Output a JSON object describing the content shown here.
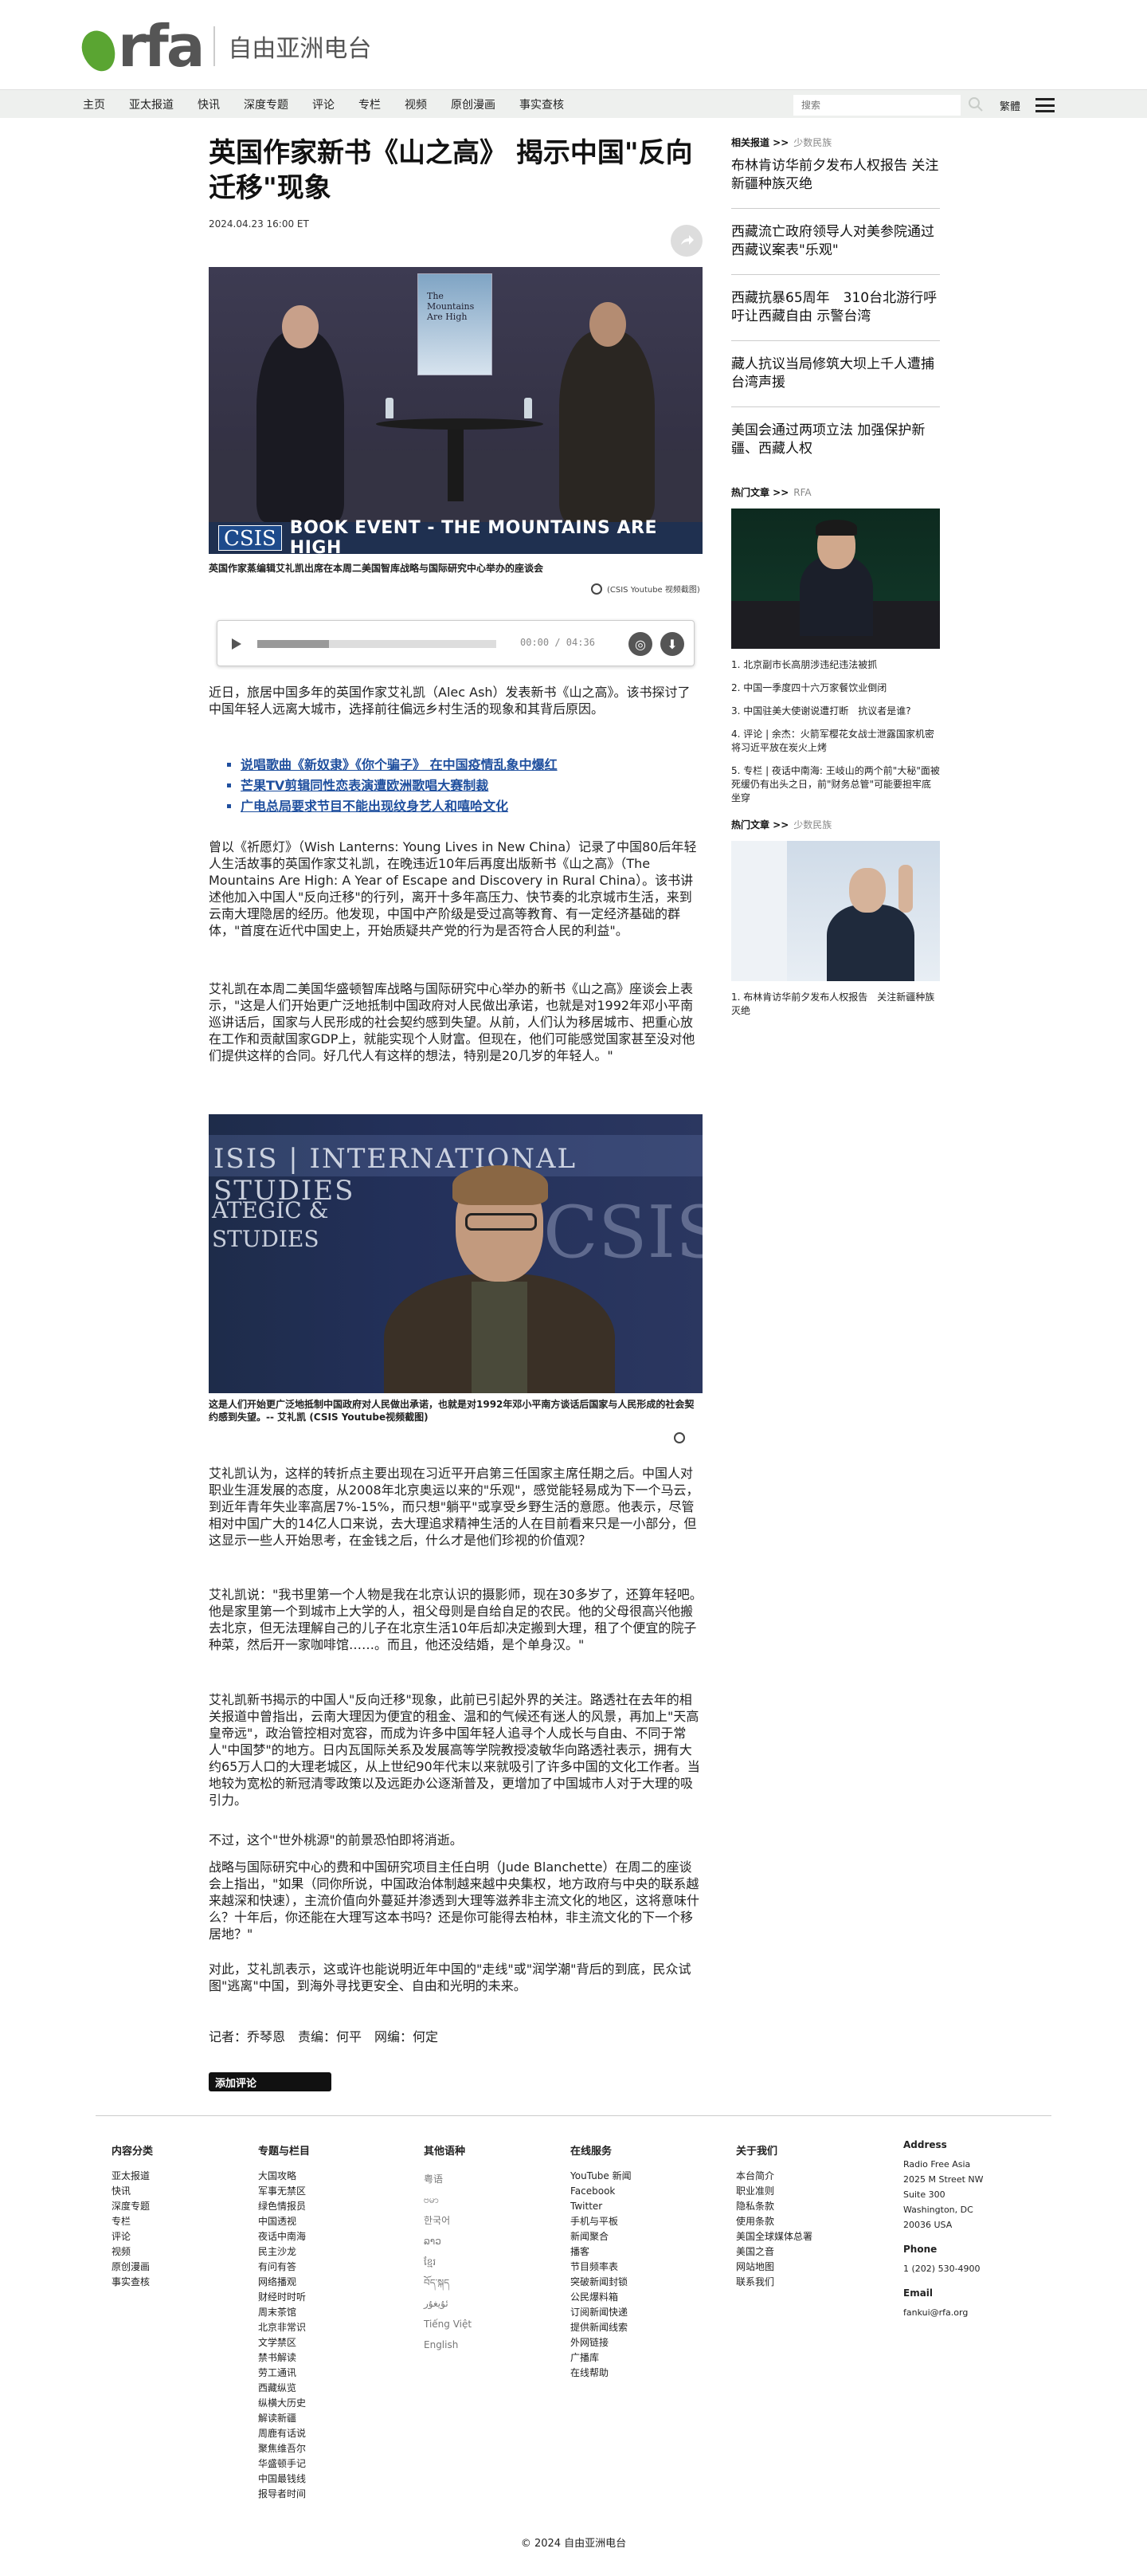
{
  "header": {
    "logo_text": "rfa",
    "site_name": "自由亚洲电台"
  },
  "nav": {
    "items": [
      "主页",
      "亚太报道",
      "快讯",
      "深度专题",
      "评论",
      "专栏",
      "视频",
      "原创漫画",
      "事实查核"
    ],
    "search_placeholder": "搜索",
    "lang_link": "繁體"
  },
  "article": {
    "headline": "英国作家新书《山之高》 揭示中国\"反向迁移\"现象",
    "date": "2024.04.23 16:00 ET",
    "hero": {
      "book_title": "The Mountains Are High",
      "banner_brand": "CSIS",
      "banner_text": "BOOK EVENT - THE MOUNTAINS ARE HIGH"
    },
    "caption1": "英国作家蒸编辑艾礼凯出席在本周二美国智库战略与国际研究中心举办的座谈会",
    "caption1_source": "(CSIS Youtube 视频截图)",
    "audio": {
      "time": "00:00 / 04:36",
      "progress": 0.3
    },
    "para1": "近日，旅居中国多年的英国作家艾礼凯（Alec Ash）发表新书《山之高》。该书探讨了中国年轻人远离大城市，选择前往偏远乡村生活的现象和其背后原因。",
    "related_links": [
      "说唱歌曲《新奴隶》《你个骗子》 在中国疫情乱象中爆红",
      "芒果TV剪辑同性恋表演遭欧洲歌唱大赛制裁",
      "广电总局要求节目不能出现纹身艺人和嘻哈文化"
    ],
    "para2": "曾以《祈愿灯》（Wish Lanterns: Young Lives in New China）记录了中国80后年轻人生活故事的英国作家艾礼凯，在晚违近10年后再度出版新书《山之高》（The Mountains Are High: A Year of Escape and Discovery in Rural China）。该书讲述他加入中国人\"反向迁移\"的行列，离开十多年高压力、快节奏的北京城市生活，来到云南大理隐居的经历。他发现，中国中产阶级是受过高等教育、有一定经济基础的群体，\"首度在近代中国史上，开始质疑共产党的行为是否符合人民的利益\"。",
    "para3": "艾礼凯在本周二美国华盛顿智库战略与国际研究中心举办的新书《山之高》座谈会上表示，\"这是人们开始更广泛地抵制中国政府对人民做出承诺，也就是对1992年邓小平南巡讲话后，国家与人民形成的社会契约感到失望。从前，人们认为移居城市、把重心放在工作和贡献国家GDP上，就能实现个人财富。但现在，他们可能感觉国家甚至没对他们提供这样的合同。好几代人有这样的想法，特别是20几岁的年轻人。\"",
    "photo2": {
      "line1": "ISIS | INTERNATIONAL STUDIES",
      "line2": "ATEGIC &",
      "line3": "STUDIES",
      "logo": "CSIS"
    },
    "caption2": "这是人们开始更广泛地抵制中国政府对人民做出承诺，也就是对1992年邓小平南方谈话后国家与人民形成的社会契约感到失望。-- 艾礼凯 (CSIS Youtube视频截图)",
    "para4": "艾礼凯认为，这样的转折点主要出现在习近平开启第三任国家主席任期之后。中国人对职业生涯发展的态度，从2008年北京奥运以来的\"乐观\"，感觉能轻易成为下一个马云，到近年青年失业率高居7%-15%，而只想\"躺平\"或享受乡野生活的意愿。他表示，尽管相对中国广大的14亿人口来说，去大理追求精神生活的人在目前看来只是一小部分，但这显示一些人开始思考，在金钱之后，什么才是他们珍视的价值观？",
    "para5": "艾礼凯说：\"我书里第一个人物是我在北京认识的摄影师，现在30多岁了，还算年轻吧。他是家里第一个到城市上大学的人，祖父母则是自给自足的农民。他的父母很高兴他搬去北京，但无法理解自己的儿子在北京生活10年后却决定搬到大理，租了个便宜的院子种菜，然后开一家咖啡馆……。而且，他还没结婚，是个单身汉。\"",
    "para6": "艾礼凯新书揭示的中国人\"反向迁移\"现象，此前已引起外界的关注。路透社在去年的相关报道中曾指出，云南大理因为便宜的租金、温和的气候还有迷人的风景，再加上\"天高皇帝远\"，政治管控相对宽容，而成为许多中国年轻人追寻个人成长与自由、不同于常人\"中国梦\"的地方。日内瓦国际关系及发展高等学院教授凌敏华向路透社表示，拥有大约65万人口的大理老城区，从上世纪90年代末以来就吸引了许多中国的文化工作者。当地较为宽松的新冠清零政策以及远距办公逐渐普及，更增加了中国城市人对于大理的吸引力。",
    "para7": "不过，这个\"世外桃源\"的前景恐怕即将消逝。",
    "para8": "战略与国际研究中心的费和中国研究项目主任白明（Jude Blanchette）在周二的座谈会上指出，\"如果（同你所说，中国政治体制越来越中央集权，地方政府与中央的联系越来越深和快速），主流价值向外蔓延并渗透到大理等滋养非主流文化的地区，这将意味什么？十年后，你还能在大理写这本书吗？还是你可能得去柏林，非主流文化的下一个移居地？\"",
    "para9": "对此，艾礼凯表示，这或许也能说明近年中国的\"走线\"或\"润学潮\"背后的到底，民众试图\"逃离\"中国，到海外寻找更安全、自由和光明的未来。",
    "credits": "记者：乔琴恩　责编：何平　网编：何定",
    "comment_button": "添加评论"
  },
  "sidebar": {
    "related_heading": "相关报道 >>",
    "related_sub": "少数民族",
    "related": [
      "布林肯访华前夕发布人权报告 关注新疆种族灭绝",
      "西藏流亡政府领导人对美参院通过西藏议案表\"乐观\"",
      "西藏抗暴65周年　310台北游行呼吁让西藏自由 示警台湾",
      "藏人抗议当局修筑大坝上千人遭捕　台湾声援",
      "美国会通过两项立法 加强保护新疆、西藏人权"
    ],
    "hot1_heading": "热门文章 >>",
    "hot1_sub": "RFA",
    "hot1_list": [
      "1. 北京副市长高朋涉违纪违法被抓",
      "2. 中国一季度四十六万家餐饮业倒闭",
      "3. 中国驻美大使谢说遭打断　抗议者是谁?",
      "4. 评论 | 余杰：火箭军樱花女战士泄露国家机密 将习近平放在炭火上烤",
      "5. 专栏 | 夜话中南海: 王岐山的两个前\"大秘\"面被死缓仍有出头之日，前\"财务总管\"可能要担牢底坐穿"
    ],
    "hot2_heading": "热门文章 >>",
    "hot2_sub": "少数民族",
    "hot2_list": [
      "1. 布林肯访华前夕发布人权报告　关注新疆种族灭绝"
    ]
  },
  "footer": {
    "col1": {
      "heading": "内容分类",
      "items": [
        "亚太报道",
        "快讯",
        "深度专题",
        "专栏",
        "评论",
        "视频",
        "原创漫画",
        "事实查核"
      ]
    },
    "col2": {
      "heading": "专题与栏目",
      "items": [
        "大国攻略",
        "军事无禁区",
        "绿色情报员",
        "中国透视",
        "夜话中南海",
        "民主沙龙",
        "有问有答",
        "网络播观",
        "财经时时听",
        "周末茶馆",
        "北京非常识",
        "文学禁区",
        "禁书解读",
        "劳工通讯",
        "西藏纵览",
        "纵横大历史",
        "解读新疆",
        "周鹿有话说",
        "聚焦维吾尔",
        "华盛顿手记",
        "中国最钱线",
        "报导者时间"
      ]
    },
    "col3": {
      "heading": "其他语种",
      "items": [
        "粤语",
        "ဗမာ",
        "한국어",
        "ລາວ",
        "ខ្មែរ",
        "བོད་སྐད",
        "ئۇيغۇر",
        "Tiếng Việt",
        "English"
      ]
    },
    "col4": {
      "heading": "在线服务",
      "items": [
        "YouTube 新闻",
        "Facebook",
        "Twitter",
        "手机与平板",
        "新闻聚合",
        "播客",
        "节目频率表",
        "突破新闻封锁",
        "公民爆料箱",
        "订阅新闻快递",
        "提供新闻线索",
        "外网链接",
        "广播库",
        "在线帮助"
      ]
    },
    "col5": {
      "heading": "关于我们",
      "items": [
        "本台简介",
        "职业准则",
        "隐私条款",
        "使用条款",
        "美国全球媒体总署",
        "美国之音",
        "网站地图",
        "联系我们"
      ]
    },
    "address": {
      "heading": "Address",
      "lines": [
        "Radio Free Asia",
        "2025 M Street NW",
        "Suite 300",
        "Washington, DC",
        "20036 USA"
      ]
    },
    "phone": {
      "heading": "Phone",
      "value": "1 (202) 530-4900"
    },
    "email": {
      "heading": "Email",
      "value": "fankui@rfa.org"
    },
    "copyright": "© 2024 自由亚洲电台"
  },
  "colors": {
    "brand_green": "#5aa532",
    "nav_bg": "#eef0ee",
    "link_blue": "#1f4f9e"
  }
}
